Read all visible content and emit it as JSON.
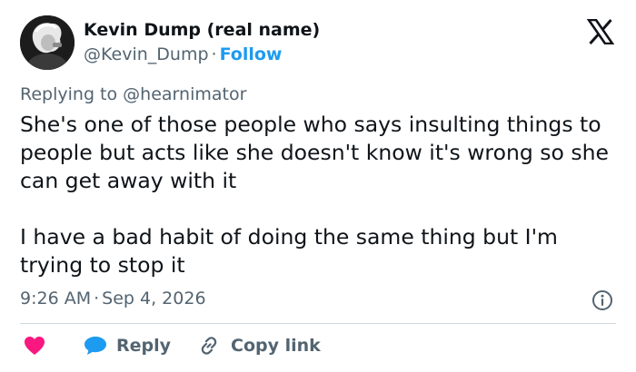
{
  "author": {
    "display_name": "Kevin Dump (real name)",
    "handle": "@Kevin_Dump",
    "separator": "·",
    "follow_label": "Follow"
  },
  "platform_logo": "x-logo-icon",
  "reply_context": {
    "prefix": "Replying to",
    "mention": "@hearnimator"
  },
  "tweet": {
    "paragraphs": [
      "She's one of those people who says insulting things to people but acts like she doesn't know it's wrong so she can get away with it",
      "I have a bad habit of doing the same thing but I'm trying to stop it"
    ]
  },
  "meta": {
    "time": "9:26 AM",
    "separator": "·",
    "date": "Sep 4, 2026",
    "info_icon": "info-icon"
  },
  "actions": {
    "like_icon": "heart-icon",
    "reply_label": "Reply",
    "reply_icon": "speech-bubble-icon",
    "copy_link_label": "Copy link",
    "copy_link_icon": "link-icon"
  },
  "colors": {
    "accent": "#1d9bf0",
    "like": "#f91880",
    "text": "#0f1419",
    "secondary_text": "#536471",
    "divider": "#cfd9de"
  }
}
